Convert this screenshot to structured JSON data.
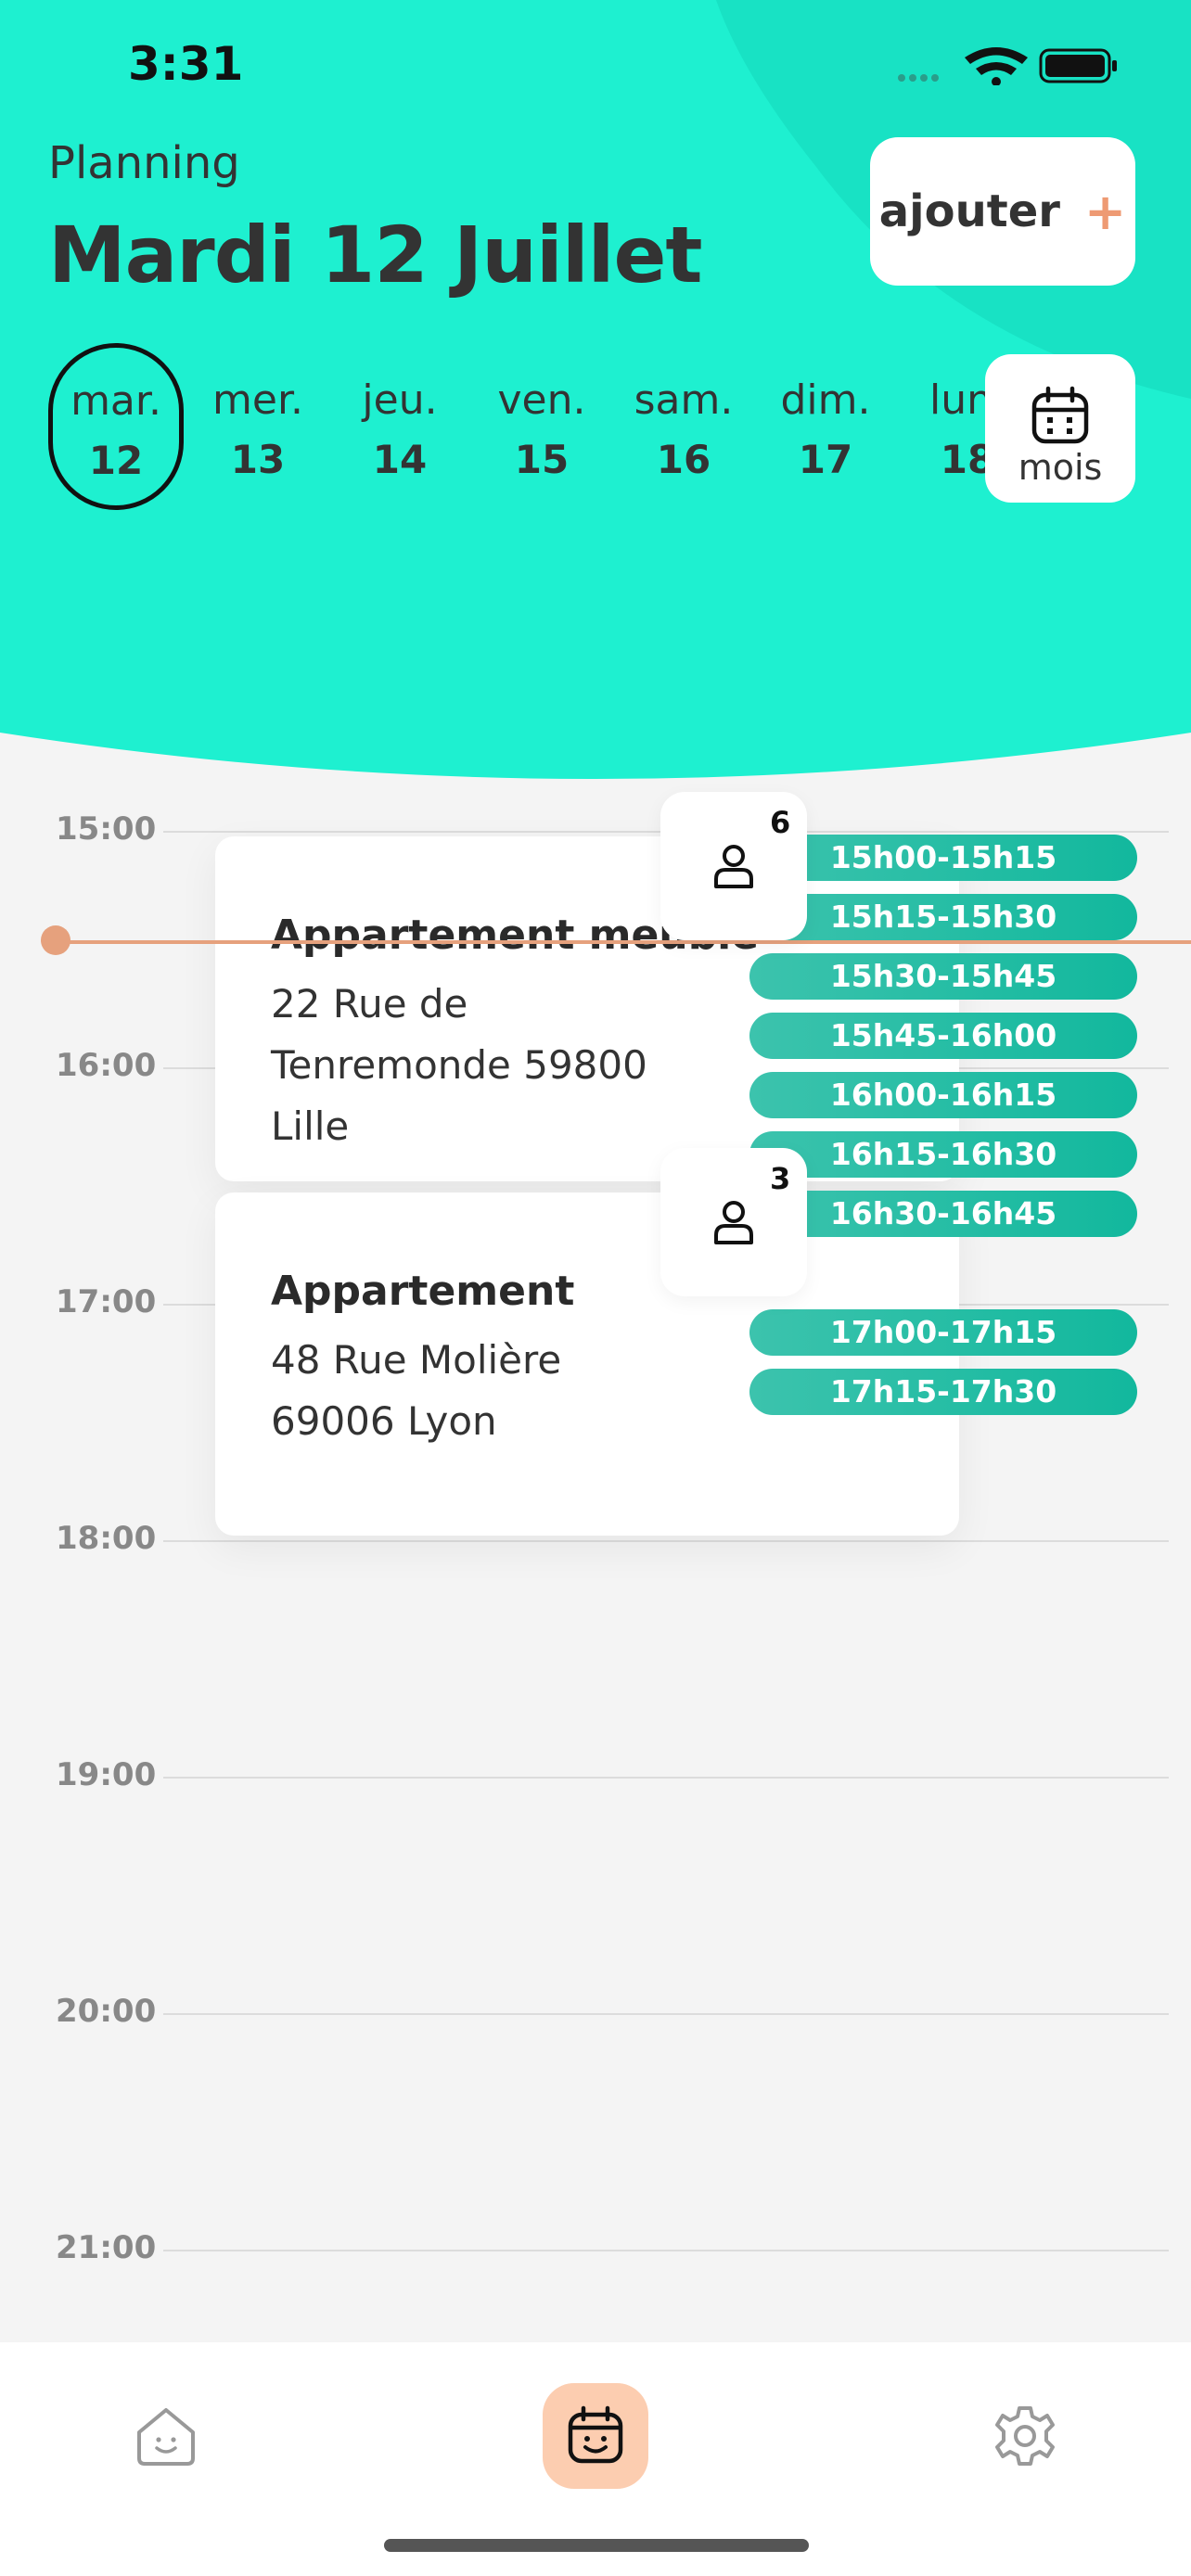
{
  "status_bar": {
    "time": "3:31"
  },
  "header": {
    "label": "Planning",
    "date_title": "Mardi 12 Juillet",
    "add_button": {
      "label": "ajouter",
      "icon": "plus-icon"
    },
    "month_button": {
      "label": "mois",
      "icon": "calendar-icon"
    }
  },
  "days": [
    {
      "name": "mar.",
      "num": "12",
      "selected": true
    },
    {
      "name": "mer.",
      "num": "13"
    },
    {
      "name": "jeu.",
      "num": "14"
    },
    {
      "name": "ven.",
      "num": "15"
    },
    {
      "name": "sam.",
      "num": "16"
    },
    {
      "name": "dim.",
      "num": "17"
    },
    {
      "name": "lun.",
      "num": "18"
    }
  ],
  "hours": [
    "15:00",
    "16:00",
    "17:00",
    "18:00",
    "19:00",
    "20:00",
    "21:00"
  ],
  "events": [
    {
      "title": "Appartement meublé",
      "address_line1": "22 Rue de",
      "address_line2": "Tenremonde 59800",
      "address_line3": "Lille",
      "guest_count": "6"
    },
    {
      "title": "Appartement",
      "address_line1": "48 Rue Molière",
      "address_line2": "69006 Lyon",
      "guest_count": "3"
    }
  ],
  "slots": [
    "15h00-15h15",
    "15h15-15h30",
    "15h30-15h45",
    "15h45-16h00",
    "16h00-16h15",
    "16h15-16h30",
    "16h30-16h45",
    "17h00-17h15",
    "17h15-17h30"
  ],
  "colors": {
    "header": "#1ef0d0",
    "accent": "#ee9a73",
    "slot": "#12b89d",
    "active_nav": "#fccdb0"
  },
  "nav": [
    {
      "name": "home",
      "icon": "home-smile-icon"
    },
    {
      "name": "planning",
      "icon": "calendar-smile-icon",
      "active": true
    },
    {
      "name": "settings",
      "icon": "gear-icon"
    }
  ]
}
